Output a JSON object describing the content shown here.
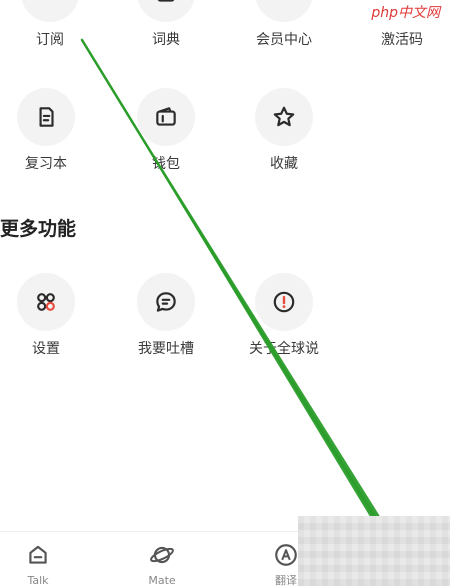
{
  "watermark": "php中文网",
  "top_row": [
    {
      "label": "订阅",
      "icon": "subscribe-icon"
    },
    {
      "label": "词典",
      "icon": "dictionary-icon"
    },
    {
      "label": "会员中心",
      "icon": "vip-icon"
    },
    {
      "label": "激活码",
      "icon": "activation-code-icon"
    }
  ],
  "second_row": [
    {
      "label": "复习本",
      "icon": "review-book-icon"
    },
    {
      "label": "钱包",
      "icon": "wallet-icon"
    },
    {
      "label": "收藏",
      "icon": "star-icon"
    }
  ],
  "more_features": {
    "title": "更多功能",
    "items": [
      {
        "label": "设置",
        "icon": "settings-grid-icon"
      },
      {
        "label": "我要吐槽",
        "icon": "feedback-bubble-icon"
      },
      {
        "label": "关于全球说",
        "icon": "about-info-icon"
      }
    ]
  },
  "tabs": [
    {
      "label": "Talk",
      "icon": "home-icon"
    },
    {
      "label": "Mate",
      "icon": "planet-icon"
    },
    {
      "label": "翻译",
      "icon": "translate-icon"
    }
  ],
  "colors": {
    "icon_stroke": "#2b2b2b",
    "accent_red": "#e84c3d",
    "annotation_green": "#2a9d2a"
  }
}
